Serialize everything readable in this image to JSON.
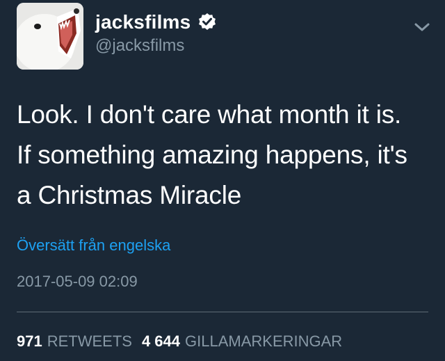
{
  "user": {
    "name": "jacksfilms",
    "handle": "@jacksfilms",
    "verified": true,
    "avatar_icon": "white-dog-avatar-icon"
  },
  "tweet": {
    "lines": [
      "Look. I don't care what month it is.",
      "If something amazing happens, it's",
      "a Christmas Miracle"
    ],
    "translate_link": "Översätt från engelska",
    "timestamp": "2017-05-09 02:09"
  },
  "stats": {
    "retweets_count": "971",
    "retweets_label": "RETWEETS",
    "likes_count": "4 644",
    "likes_label": "GILLAMARKERINGAR"
  },
  "colors": {
    "background": "#1b2836",
    "accent": "#1da1f2",
    "muted": "#8899a6"
  }
}
